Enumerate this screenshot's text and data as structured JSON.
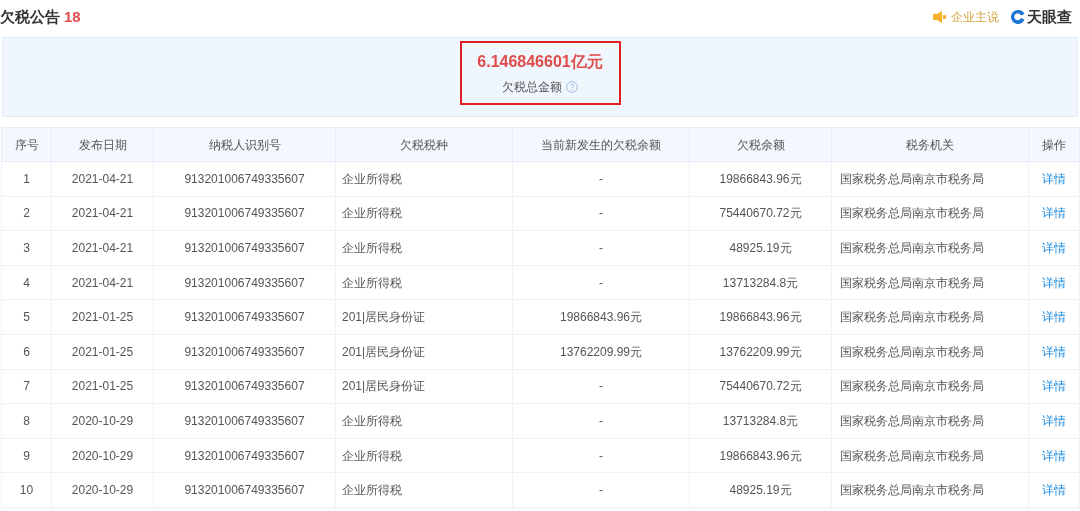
{
  "header": {
    "title": "欠税公告",
    "count": "18",
    "promo": "企业主说",
    "brand": "天眼查"
  },
  "summary": {
    "amount": "6.146846601亿元",
    "label": "欠税总金额"
  },
  "table": {
    "columns": [
      "序号",
      "发布日期",
      "纳税人识别号",
      "欠税税种",
      "当前新发生的欠税余额",
      "欠税余额",
      "税务机关",
      "操作"
    ],
    "rows": [
      [
        "1",
        "2021-04-21",
        "913201006749335607",
        "企业所得税",
        "-",
        "19866843.96元",
        "国家税务总局南京市税务局",
        "详情"
      ],
      [
        "2",
        "2021-04-21",
        "913201006749335607",
        "企业所得税",
        "-",
        "75440670.72元",
        "国家税务总局南京市税务局",
        "详情"
      ],
      [
        "3",
        "2021-04-21",
        "913201006749335607",
        "企业所得税",
        "-",
        "48925.19元",
        "国家税务总局南京市税务局",
        "详情"
      ],
      [
        "4",
        "2021-04-21",
        "913201006749335607",
        "企业所得税",
        "-",
        "13713284.8元",
        "国家税务总局南京市税务局",
        "详情"
      ],
      [
        "5",
        "2021-01-25",
        "913201006749335607",
        "201|居民身份证",
        "19866843.96元",
        "19866843.96元",
        "国家税务总局南京市税务局",
        "详情"
      ],
      [
        "6",
        "2021-01-25",
        "913201006749335607",
        "201|居民身份证",
        "13762209.99元",
        "13762209.99元",
        "国家税务总局南京市税务局",
        "详情"
      ],
      [
        "7",
        "2021-01-25",
        "913201006749335607",
        "201|居民身份证",
        "-",
        "75440670.72元",
        "国家税务总局南京市税务局",
        "详情"
      ],
      [
        "8",
        "2020-10-29",
        "913201006749335607",
        "企业所得税",
        "-",
        "13713284.8元",
        "国家税务总局南京市税务局",
        "详情"
      ],
      [
        "9",
        "2020-10-29",
        "913201006749335607",
        "企业所得税",
        "-",
        "19866843.96元",
        "国家税务总局南京市税务局",
        "详情"
      ],
      [
        "10",
        "2020-10-29",
        "913201006749335607",
        "企业所得税",
        "-",
        "48925.19元",
        "国家税务总局南京市税务局",
        "详情"
      ]
    ]
  }
}
